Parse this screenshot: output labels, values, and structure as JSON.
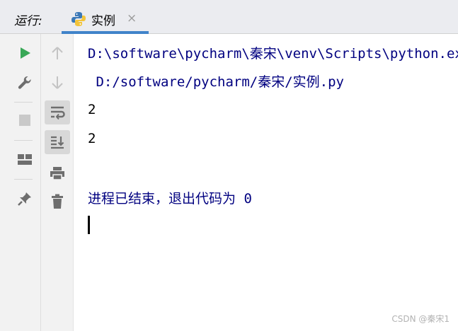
{
  "header": {
    "run_label": "运行",
    "run_label_colon": ":",
    "tab": {
      "title": "实例",
      "close": "×",
      "icon": "python-icon"
    }
  },
  "gutter_left": {
    "icons": [
      "run-icon",
      "wrench-icon",
      "stop-icon",
      "layout-icon",
      "pin-icon"
    ]
  },
  "gutter_right": {
    "icons": [
      "arrow-up-icon",
      "arrow-down-icon",
      "soft-wrap-icon",
      "scroll-to-end-icon",
      "print-icon",
      "trash-icon"
    ]
  },
  "console": {
    "lines": [
      "D:\\software\\pycharm\\秦宋\\venv\\Scripts\\python.exe",
      " D:/software/pycharm/秦宋/实例.py",
      "2",
      "2",
      "",
      "进程已结束，退出代码为 0"
    ]
  },
  "watermark": "CSDN @秦宋1",
  "colors": {
    "header_bg": "#ebecf0",
    "tab_underline": "#4083c9",
    "run_green": "#39a857",
    "command_text": "#000080",
    "icon_gray": "#6e6e6e"
  }
}
